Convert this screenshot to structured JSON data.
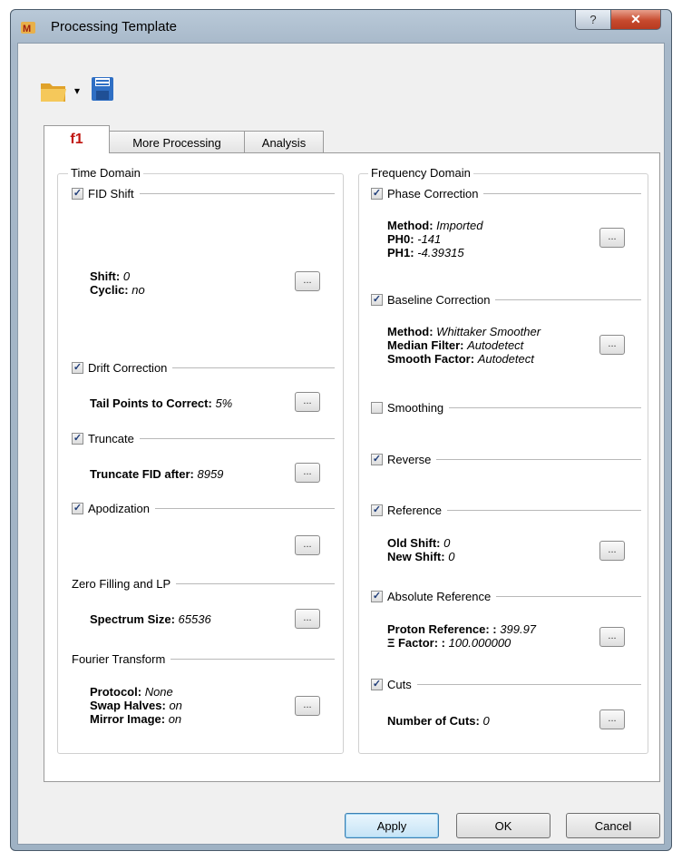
{
  "window": {
    "title": "Processing Template",
    "help_glyph": "?",
    "close_glyph": "✕"
  },
  "toolbar": {
    "open_icon": "folder-open-icon",
    "dropdown_glyph": "▾",
    "save_icon": "floppy-disk-icon"
  },
  "tabs": [
    {
      "label": "f1",
      "active": true
    },
    {
      "label": "More Processing",
      "active": false
    },
    {
      "label": "Analysis",
      "active": false
    }
  ],
  "time_domain": {
    "title": "Time Domain",
    "fid_shift": {
      "label": "FID Shift",
      "checked": true,
      "shift_label": "Shift:",
      "shift_value": "0",
      "cyclic_label": "Cyclic:",
      "cyclic_value": "no"
    },
    "drift": {
      "label": "Drift Correction",
      "checked": true,
      "tail_label": "Tail Points to Correct:",
      "tail_value": "5%"
    },
    "truncate": {
      "label": "Truncate",
      "checked": true,
      "after_label": "Truncate FID after:",
      "after_value": "8959"
    },
    "apodization": {
      "label": "Apodization",
      "checked": true
    },
    "zero_fill": {
      "title": "Zero Filling and LP",
      "size_label": "Spectrum Size:",
      "size_value": "65536"
    },
    "fourier": {
      "title": "Fourier Transform",
      "protocol_label": "Protocol:",
      "protocol_value": "None",
      "swap_label": "Swap Halves:",
      "swap_value": "on",
      "mirror_label": "Mirror Image:",
      "mirror_value": "on"
    }
  },
  "freq_domain": {
    "title": "Frequency Domain",
    "phase": {
      "label": "Phase Correction",
      "checked": true,
      "method_label": "Method:",
      "method_value": "Imported",
      "ph0_label": "PH0:",
      "ph0_value": "-141",
      "ph1_label": "PH1:",
      "ph1_value": "-4.39315"
    },
    "baseline": {
      "label": "Baseline Correction",
      "checked": true,
      "method_label": "Method:",
      "method_value": "Whittaker Smoother",
      "median_label": "Median Filter:",
      "median_value": "Autodetect",
      "smooth_label": "Smooth Factor:",
      "smooth_value": "Autodetect"
    },
    "smoothing": {
      "label": "Smoothing",
      "checked": false
    },
    "reverse": {
      "label": "Reverse",
      "checked": true
    },
    "reference": {
      "label": "Reference",
      "checked": true,
      "old_label": "Old Shift:",
      "old_value": "0",
      "new_label": "New Shift:",
      "new_value": "0"
    },
    "absolute": {
      "label": "Absolute Reference",
      "checked": true,
      "proton_label": "Proton Reference: :",
      "proton_value": "399.97",
      "factor_label": "Ξ Factor: :",
      "factor_value": "100.000000"
    },
    "cuts": {
      "label": "Cuts",
      "checked": true,
      "num_label": "Number of Cuts:",
      "num_value": "0"
    }
  },
  "ellipsis": "...",
  "check_glyph": "✓",
  "buttons": {
    "apply": "Apply",
    "ok": "OK",
    "cancel": "Cancel"
  }
}
